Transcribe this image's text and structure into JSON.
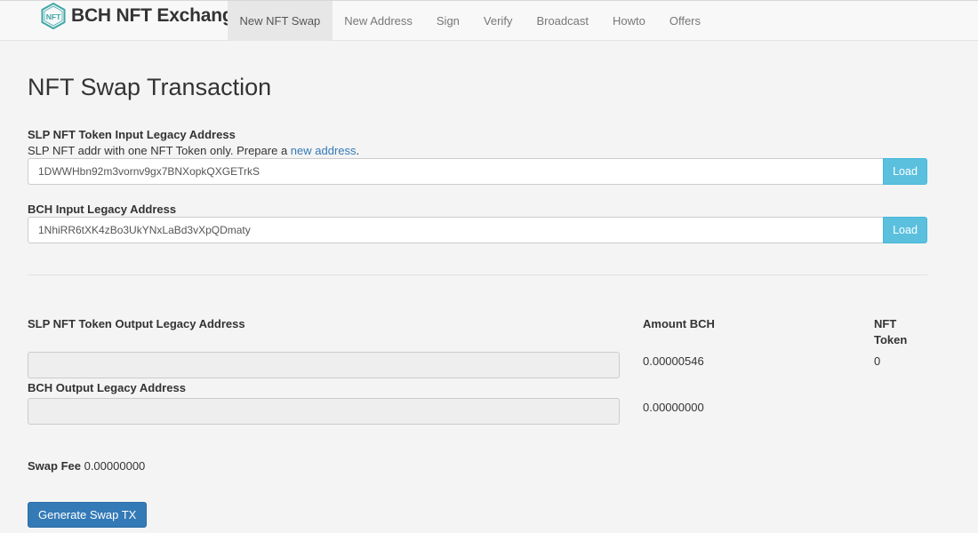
{
  "brand": {
    "name": "BCH NFT Exchange",
    "logo_text": "NFT",
    "accent_color": "#3fa7a7"
  },
  "nav": {
    "items": [
      {
        "label": "New NFT Swap",
        "active": true
      },
      {
        "label": "New Address"
      },
      {
        "label": "Sign"
      },
      {
        "label": "Verify"
      },
      {
        "label": "Broadcast"
      },
      {
        "label": "Howto"
      },
      {
        "label": "Offers"
      }
    ]
  },
  "page": {
    "title": "NFT Swap Transaction"
  },
  "slp_input": {
    "label": "SLP NFT Token Input Legacy Address",
    "help_prefix": "SLP NFT addr with one NFT Token only. Prepare a ",
    "help_link": "new address",
    "help_suffix": ".",
    "value": "1DWWHbn92m3vornv9gx7BNXopkQXGETrkS",
    "button": "Load"
  },
  "bch_input": {
    "label": "BCH Input Legacy Address",
    "value": "1NhiRR6tXK4zBo3UkYNxLaBd3vXpQDmaty",
    "button": "Load"
  },
  "outputs": {
    "col_address": "SLP NFT Token Output Legacy Address",
    "col_amount": "Amount BCH",
    "col_token_line1": "NFT",
    "col_token_line2": "Token",
    "slp_amount": "0.00000546",
    "slp_token": "0",
    "bch_label": "BCH Output Legacy Address",
    "bch_amount": "0.00000000"
  },
  "fee": {
    "label": "Swap Fee",
    "value": "0.00000000"
  },
  "actions": {
    "generate": "Generate Swap TX"
  },
  "colors": {
    "load_button": "#5bc0de",
    "primary_button": "#337ab7",
    "link": "#337ab7"
  }
}
